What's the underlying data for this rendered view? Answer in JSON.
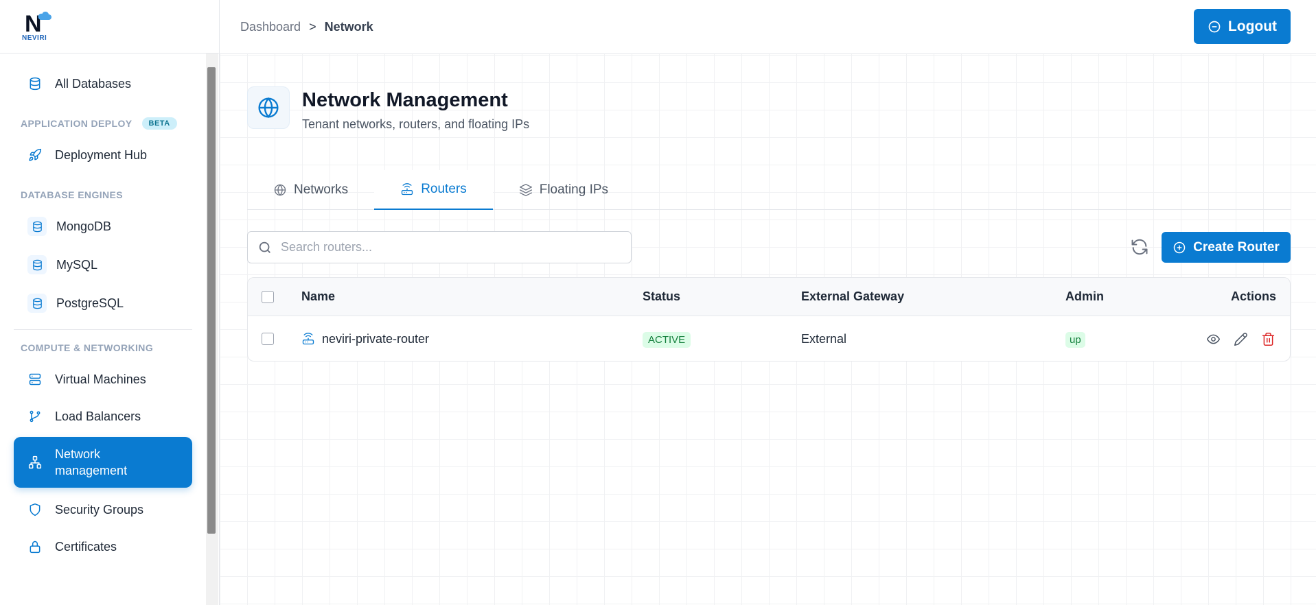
{
  "brand": {
    "name": "NEVIRI",
    "logo_letter": "N"
  },
  "sidebar": {
    "top_item": {
      "label": "All Databases",
      "icon": "database-icon"
    },
    "sections": [
      {
        "label": "APPLICATION DEPLOY",
        "badge": "BETA",
        "items": [
          {
            "label": "Deployment Hub",
            "icon": "rocket-icon"
          }
        ]
      },
      {
        "label": "DATABASE ENGINES",
        "items": [
          {
            "label": "MongoDB",
            "icon": "database-icon"
          },
          {
            "label": "MySQL",
            "icon": "database-icon"
          },
          {
            "label": "PostgreSQL",
            "icon": "database-icon"
          }
        ]
      },
      {
        "label": "COMPUTE & NETWORKING",
        "items": [
          {
            "label": "Virtual Machines",
            "icon": "server-icon"
          },
          {
            "label": "Load Balancers",
            "icon": "git-branch-icon"
          },
          {
            "label": "Network management",
            "icon": "network-icon",
            "active": true
          },
          {
            "label": "Security Groups",
            "icon": "shield-icon"
          },
          {
            "label": "Certificates",
            "icon": "lock-icon"
          }
        ]
      }
    ]
  },
  "header": {
    "breadcrumb": [
      "Dashboard",
      "Network"
    ],
    "breadcrumb_separator": ">",
    "logout_label": "Logout"
  },
  "page": {
    "title": "Network Management",
    "subtitle": "Tenant networks, routers, and floating IPs",
    "icon": "globe-icon"
  },
  "tabs": [
    {
      "label": "Networks",
      "icon": "globe-icon"
    },
    {
      "label": "Routers",
      "icon": "router-icon",
      "active": true
    },
    {
      "label": "Floating IPs",
      "icon": "layers-icon"
    }
  ],
  "toolbar": {
    "search_placeholder": "Search routers...",
    "search_value": "",
    "create_label": "Create Router"
  },
  "table": {
    "columns": [
      "Name",
      "Status",
      "External Gateway",
      "Admin",
      "Actions"
    ],
    "rows": [
      {
        "name": "neviri-private-router",
        "status": "ACTIVE",
        "external_gateway": "External",
        "admin": "up"
      }
    ]
  },
  "colors": {
    "primary": "#0a7bd1",
    "success_bg": "#dcfce7",
    "success_text": "#15803d",
    "danger": "#dc2626"
  }
}
